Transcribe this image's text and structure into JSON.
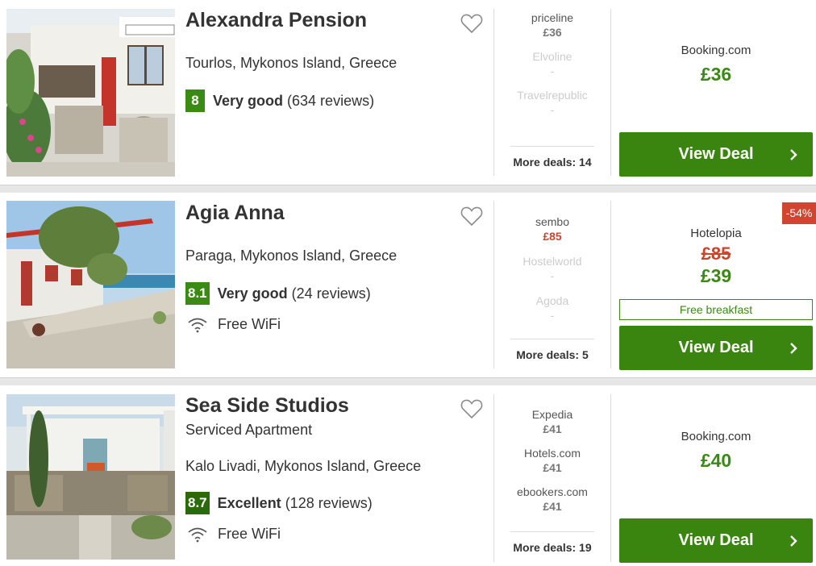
{
  "hotels": [
    {
      "name": "Alexandra Pension",
      "location": "Tourlos, Mykonos Island, Greece",
      "score": "8",
      "rating_text": "Very good",
      "reviews": "(634 reviews)",
      "deals": [
        {
          "provider": "priceline",
          "price": "£36"
        },
        {
          "provider": "Elvoline",
          "price": "-"
        },
        {
          "provider": "Travelrepublic",
          "price": "-"
        }
      ],
      "more_deals": "More deals: 14",
      "best": {
        "provider": "Booking.com",
        "price": "£36"
      },
      "button": "View Deal"
    },
    {
      "name": "Agia Anna",
      "location": "Paraga, Mykonos Island, Greece",
      "score": "8.1",
      "rating_text": "Very good",
      "reviews": "(24 reviews)",
      "amenity": "Free WiFi",
      "deals": [
        {
          "provider": "sembo",
          "price": "£85"
        },
        {
          "provider": "Hostelworld",
          "price": "-"
        },
        {
          "provider": "Agoda",
          "price": "-"
        }
      ],
      "more_deals": "More deals: 5",
      "discount": "-54%",
      "best": {
        "provider": "Hotelopia",
        "old_price": "£85",
        "price": "£39"
      },
      "extra": "Free breakfast",
      "button": "View Deal"
    },
    {
      "name": "Sea Side Studios",
      "subtype": "Serviced Apartment",
      "location": "Kalo Livadi, Mykonos Island, Greece",
      "score": "8.7",
      "rating_text": "Excellent",
      "reviews": "(128 reviews)",
      "amenity": "Free WiFi",
      "deals": [
        {
          "provider": "Expedia",
          "price": "£41"
        },
        {
          "provider": "Hotels.com",
          "price": "£41"
        },
        {
          "provider": "ebookers.com",
          "price": "£41"
        }
      ],
      "more_deals": "More deals: 19",
      "best": {
        "provider": "Booking.com",
        "price": "£40"
      },
      "button": "View Deal"
    }
  ],
  "colors": {
    "deal_green": "#3a8510",
    "score_green": "#3b8a13",
    "discount_red": "#d14530",
    "strike_red": "#c9452b"
  },
  "icons": {
    "favorite": "heart-icon",
    "wifi": "wifi-icon",
    "arrow": "chevron-right-icon"
  }
}
